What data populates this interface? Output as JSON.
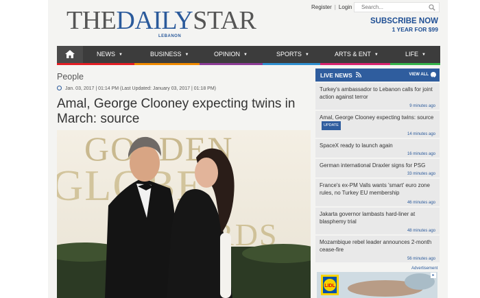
{
  "header": {
    "logo": {
      "the": "THE",
      "daily": "DAILY",
      "star": "STAR",
      "sub": "LEBANON"
    },
    "links": {
      "register": "Register",
      "separator": "|",
      "login": "Login"
    },
    "search": {
      "placeholder": "Search..."
    },
    "subscribe": {
      "line1": "SUBSCRIBE NOW",
      "line2": "1 YEAR FOR $99"
    }
  },
  "nav": {
    "items": [
      {
        "label": "NEWS",
        "color": "#e31e24"
      },
      {
        "label": "BUSINESS",
        "color": "#f08a00"
      },
      {
        "label": "OPINION",
        "color": "#8c3b96"
      },
      {
        "label": "SPORTS",
        "color": "#2f8fd0"
      },
      {
        "label": "ARTS & ENT",
        "color": "#d8226e"
      },
      {
        "label": "LIFE",
        "color": "#34b34a"
      }
    ]
  },
  "article": {
    "section": "People",
    "date": "Jan. 03, 2017 | 01:14 PM (Last Updated: January 03, 2017 | 01:18 PM)",
    "headline": "Amal, George Clooney expecting twins in March: source"
  },
  "live_news": {
    "title": "LIVE NEWS",
    "view_all": "VIEW ALL",
    "items": [
      {
        "text": "Turkey's ambassador to Lebanon calls for joint action against terror",
        "time": "9 minutes ago"
      },
      {
        "text": "Amal, George Clooney expecting twins: source",
        "badge": "UPDATE",
        "time": "14 minutes ago"
      },
      {
        "text": "SpaceX ready to launch again",
        "time": "16 minutes ago"
      },
      {
        "text": "German international Draxler signs for PSG",
        "time": "33 minutes ago"
      },
      {
        "text": "France's ex-PM Valls wants 'smart' euro zone rules, no Turkey EU membership",
        "time": "46 minutes ago"
      },
      {
        "text": "Jakarta governor lambasts hard-liner at blasphemy trial",
        "time": "48 minutes ago"
      },
      {
        "text": "Mozambique rebel leader announces 2-month cease-fire",
        "time": "56 minutes ago"
      }
    ]
  },
  "ad": {
    "label": "Advertisement",
    "brand": "LIDL"
  },
  "photo": {
    "backdrop_text": [
      "GOLDEN",
      "GLOBE",
      "AWARDS"
    ]
  },
  "colors": {
    "brand_blue": "#2b5a9b",
    "nav_bg": "#3c3c3c",
    "live_head": "#2f5d9e"
  }
}
